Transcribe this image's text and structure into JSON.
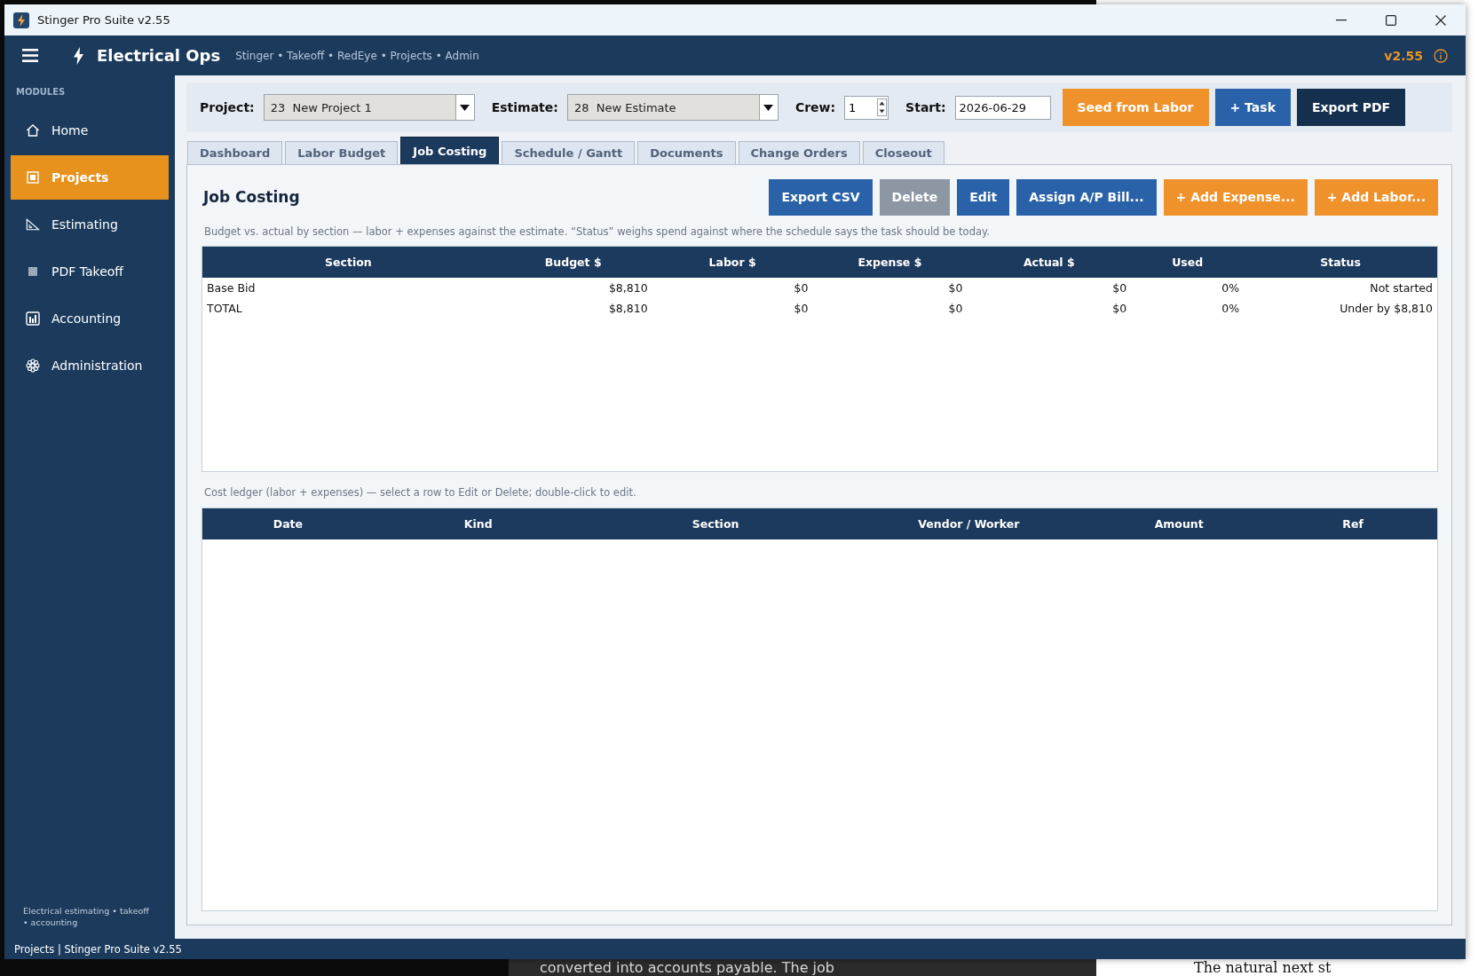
{
  "window": {
    "title": "Stinger Pro Suite v2.55"
  },
  "header": {
    "title": "Electrical Ops",
    "subtitle": "Stinger • Takeoff • RedEye • Projects • Admin",
    "version": "v2.55"
  },
  "sidebar": {
    "heading": "MODULES",
    "items": [
      {
        "label": "Home",
        "selected": false
      },
      {
        "label": "Projects",
        "selected": true
      },
      {
        "label": "Estimating",
        "selected": false
      },
      {
        "label": "PDF Takeoff",
        "selected": false
      },
      {
        "label": "Accounting",
        "selected": false
      },
      {
        "label": "Administration",
        "selected": false
      }
    ],
    "footer": "Electrical estimating • takeoff • accounting"
  },
  "toolbar": {
    "fields": [
      {
        "kind": "dropdown",
        "label": "Project:",
        "value": "23  New Project 1"
      },
      {
        "kind": "dropdown",
        "label": "Estimate:",
        "value": "28  New Estimate"
      },
      {
        "kind": "spinbox",
        "label": "Crew:",
        "value": "1"
      },
      {
        "kind": "date",
        "label": "Start:",
        "value": "2026-06-29"
      }
    ],
    "buttons": [
      {
        "label": "Seed from Labor",
        "kind": "accent"
      },
      {
        "label": "+ Task",
        "kind": "primary"
      },
      {
        "label": "Export PDF",
        "kind": "dark"
      }
    ]
  },
  "tabs": [
    {
      "label": "Dashboard",
      "selected": false
    },
    {
      "label": "Labor Budget",
      "selected": false
    },
    {
      "label": "Job Costing",
      "selected": true
    },
    {
      "label": "Schedule / Gantt",
      "selected": false
    },
    {
      "label": "Documents",
      "selected": false
    },
    {
      "label": "Change Orders",
      "selected": false
    },
    {
      "label": "Closeout",
      "selected": false
    }
  ],
  "job_costing": {
    "title": "Job Costing",
    "buttons": [
      {
        "label": "Export CSV",
        "kind": "primary"
      },
      {
        "label": "Delete",
        "kind": "secondary"
      },
      {
        "label": "Edit",
        "kind": "primary"
      },
      {
        "label": "Assign A/P Bill...",
        "kind": "primary"
      },
      {
        "label": "+ Add Expense...",
        "kind": "accent"
      },
      {
        "label": "+ Add Labor...",
        "kind": "accent"
      }
    ],
    "description": "Budget vs. actual by section — labor + expenses against the estimate. “Status” weighs spend against where the schedule says the task should be today.",
    "budget_table": {
      "columns": [
        "Section",
        "Budget $",
        "Labor $",
        "Expense $",
        "Actual $",
        "Used",
        "Status"
      ],
      "rows": [
        [
          "Base Bid",
          "$8,810",
          "$0",
          "$0",
          "$0",
          "0%",
          "Not started"
        ],
        [
          "TOTAL",
          "$8,810",
          "$0",
          "$0",
          "$0",
          "0%",
          "Under by $8,810"
        ]
      ]
    },
    "ledger_caption": "Cost ledger (labor + expenses) — select a row to Edit or Delete; double-click to edit.",
    "ledger_table": {
      "columns": [
        "Date",
        "Kind",
        "Section",
        "Vendor / Worker",
        "Amount",
        "Ref"
      ]
    }
  },
  "status_bar": {
    "text": "Projects | Stinger Pro Suite v2.55"
  },
  "background": {
    "window_text": "converted into accounts payable. The job",
    "page_text": "The natural next st"
  }
}
